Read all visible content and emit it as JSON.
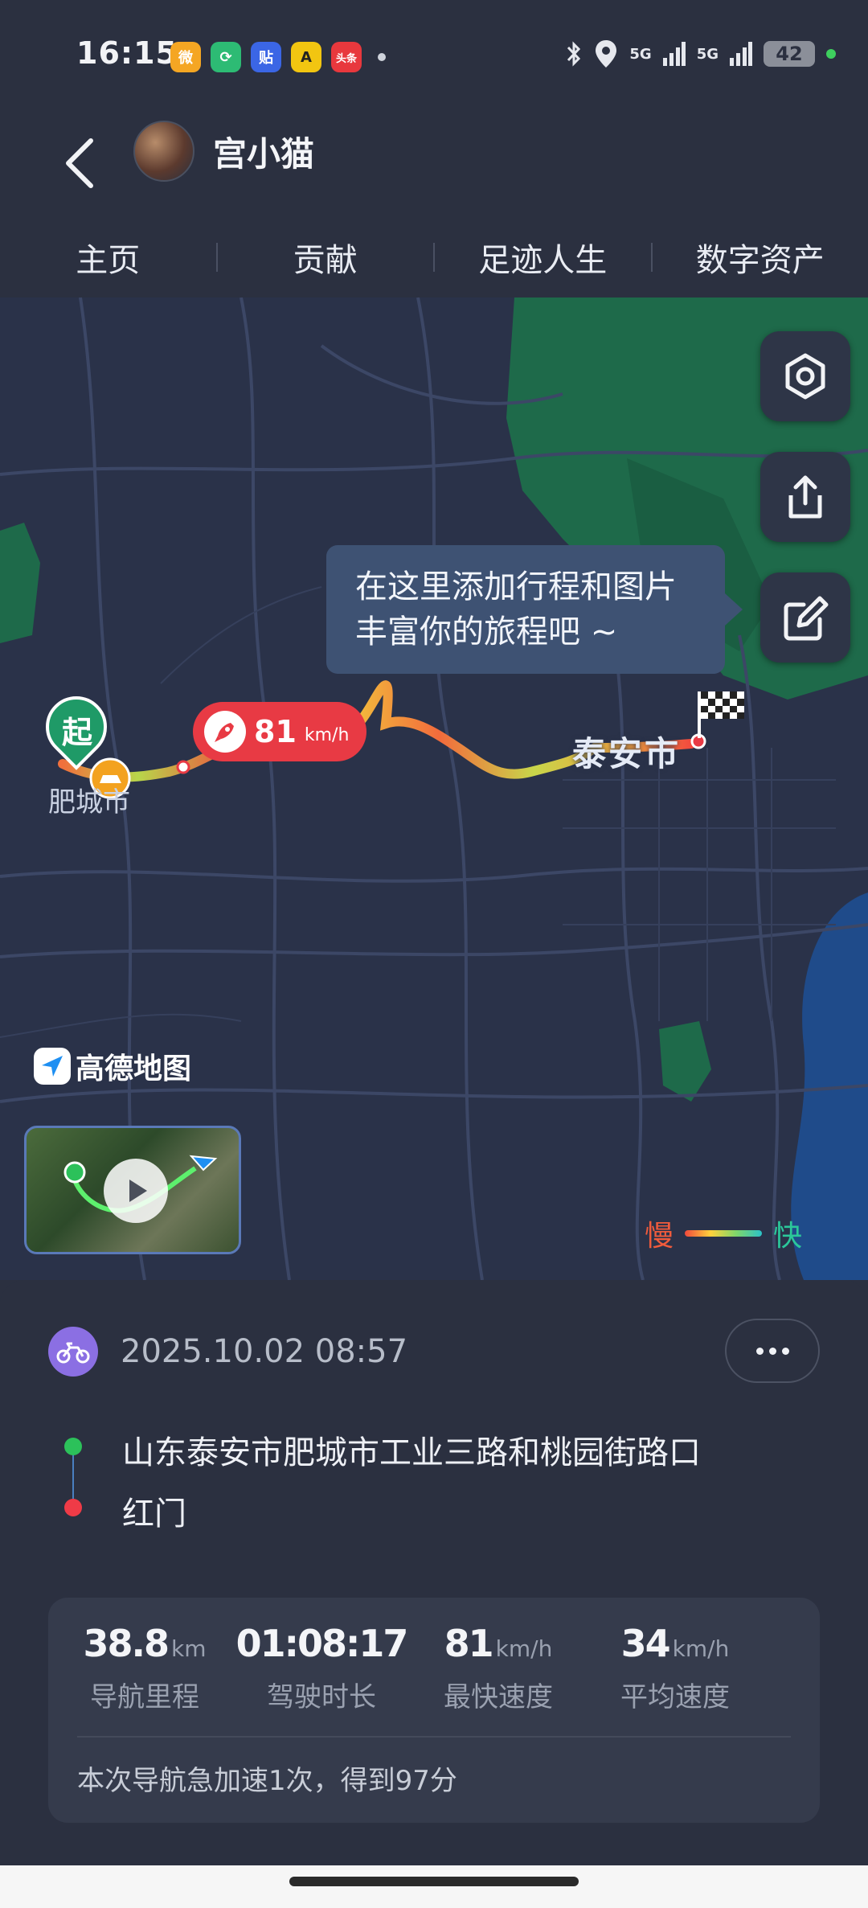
{
  "status_bar": {
    "time": "16:15",
    "notifications": [
      {
        "icon": "weibo-icon",
        "color": "#f5a623",
        "glyph": "微"
      },
      {
        "icon": "app-green-icon",
        "color": "#2dbb74",
        "glyph": "⟳"
      },
      {
        "icon": "tieba-icon",
        "color": "#3b66e5",
        "glyph": "贴"
      },
      {
        "icon": "app-yellow-icon",
        "color": "#f2c511",
        "glyph": "A"
      },
      {
        "icon": "toutiao-icon",
        "color": "#e8383d",
        "glyph": "头条"
      }
    ],
    "signal_1": "5G",
    "signal_2": "5G",
    "battery": "42"
  },
  "header": {
    "username": "宫小猫"
  },
  "tabs": [
    {
      "label": "主页"
    },
    {
      "label": "贡献"
    },
    {
      "label": "足迹人生"
    },
    {
      "label": "数字资产"
    }
  ],
  "map": {
    "tooltip_line1": "在这里添加行程和图片",
    "tooltip_line2": "丰富你的旅程吧 ~",
    "start_label": "起",
    "start_city": "肥城市",
    "end_city": "泰安市",
    "max_speed_value": "81",
    "max_speed_unit": "km/h",
    "brand": "高德地图",
    "legend_slow": "慢",
    "legend_fast": "快",
    "controls": [
      "settings-icon",
      "share-icon",
      "edit-icon"
    ]
  },
  "trip": {
    "datetime": "2025.10.02 08:57",
    "start_address": "山东泰安市肥城市工业三路和桃园街路口",
    "end_address": "红门",
    "stats": [
      {
        "value": "38.8",
        "unit": "km",
        "label": "导航里程"
      },
      {
        "value": "01:08:17",
        "unit": "",
        "label": "驾驶时长"
      },
      {
        "value": "81",
        "unit": "km/h",
        "label": "最快速度"
      },
      {
        "value": "34",
        "unit": "km/h",
        "label": "平均速度"
      }
    ],
    "note": "本次导航急加速1次，得到97分"
  },
  "colors": {
    "background": "#2b3040",
    "map_bg": "#2a3249",
    "speed_tag": "#e83a44",
    "route_slow": "#f0493c",
    "route_fast": "#7fd66a"
  }
}
